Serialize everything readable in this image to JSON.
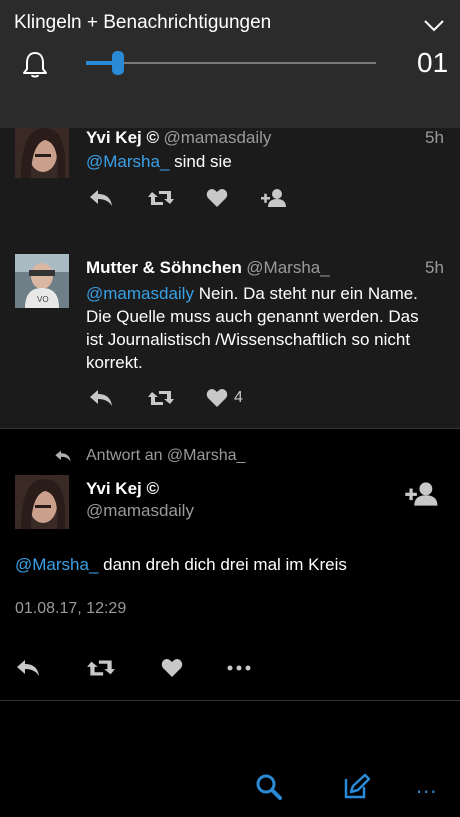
{
  "volume_panel": {
    "title": "Klingeln + Benachrichtigungen",
    "level_value": "01",
    "level_fraction": 0.11
  },
  "tweets": [
    {
      "author": "Yvi Kej ©",
      "handle": "@mamasdaily",
      "time": "5h",
      "mention": "@Marsha_",
      "text": "sind sie",
      "like_count": ""
    },
    {
      "author": "Mutter & Söhnchen",
      "handle": "@Marsha_",
      "time": "5h",
      "mention": "@mamasdaily",
      "text_line1": "Nein. Da steht nur ein Name.",
      "text_line2": "Die Quelle muss auch genannt werden. Das",
      "text_line3": "ist Journalistisch /Wissenschaftlich so nicht",
      "text_line4": "korrekt.",
      "like_count": "4"
    }
  ],
  "detail": {
    "reply_to": "Antwort an @Marsha_",
    "author": "Yvi Kej ©",
    "handle": "@mamasdaily",
    "mention": "@Marsha_",
    "text": "dann dreh dich drei mal im Kreis",
    "timestamp": "01.08.17, 12:29"
  },
  "bottom_bar": {
    "more": "..."
  },
  "icons": {
    "reply": "reply-icon",
    "retweet": "retweet-icon",
    "like": "heart-icon",
    "follow": "follow-user-icon",
    "more": "more-icon",
    "search": "search-icon",
    "compose": "compose-icon",
    "bell": "bell-icon",
    "chevron": "chevron-down-icon"
  },
  "colors": {
    "accent": "#2b8ad6",
    "mention": "#3aa0e6",
    "panel": "#2b2b2b",
    "tweet_bg": "#1b1b1b"
  }
}
